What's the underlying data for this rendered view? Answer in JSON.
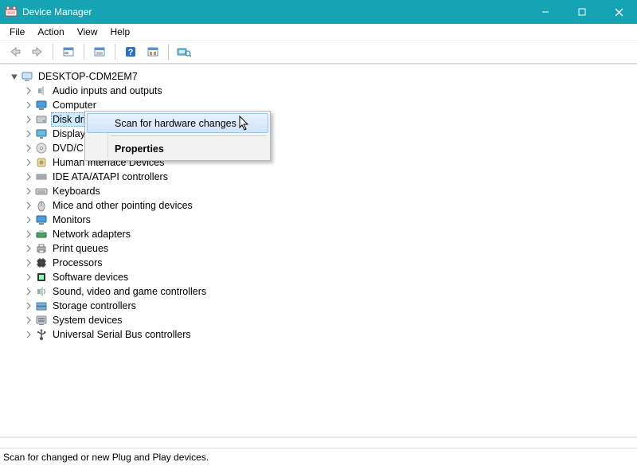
{
  "window": {
    "title": "Device Manager"
  },
  "menu": {
    "file": "File",
    "action": "Action",
    "view": "View",
    "help": "Help"
  },
  "tree": {
    "root": "DESKTOP-CDM2EM7",
    "items": [
      {
        "label": "Audio inputs and outputs",
        "icon": "speaker"
      },
      {
        "label": "Computer",
        "icon": "monitor"
      },
      {
        "label": "Disk dri",
        "icon": "disk",
        "selected": true
      },
      {
        "label": "Display",
        "icon": "display"
      },
      {
        "label": "DVD/C",
        "icon": "dvd"
      },
      {
        "label": "Human Interface Devices",
        "icon": "hid",
        "cut": true
      },
      {
        "label": "IDE ATA/ATAPI controllers",
        "icon": "ide"
      },
      {
        "label": "Keyboards",
        "icon": "keyboard"
      },
      {
        "label": "Mice and other pointing devices",
        "icon": "mouse"
      },
      {
        "label": "Monitors",
        "icon": "monitor"
      },
      {
        "label": "Network adapters",
        "icon": "network"
      },
      {
        "label": "Print queues",
        "icon": "printer"
      },
      {
        "label": "Processors",
        "icon": "cpu"
      },
      {
        "label": "Software devices",
        "icon": "software"
      },
      {
        "label": "Sound, video and game controllers",
        "icon": "sound"
      },
      {
        "label": "Storage controllers",
        "icon": "storage"
      },
      {
        "label": "System devices",
        "icon": "system"
      },
      {
        "label": "Universal Serial Bus controllers",
        "icon": "usb"
      }
    ]
  },
  "context_menu": {
    "scan": "Scan for hardware changes",
    "properties": "Properties"
  },
  "status": {
    "text": "Scan for changed or new Plug and Play devices."
  }
}
